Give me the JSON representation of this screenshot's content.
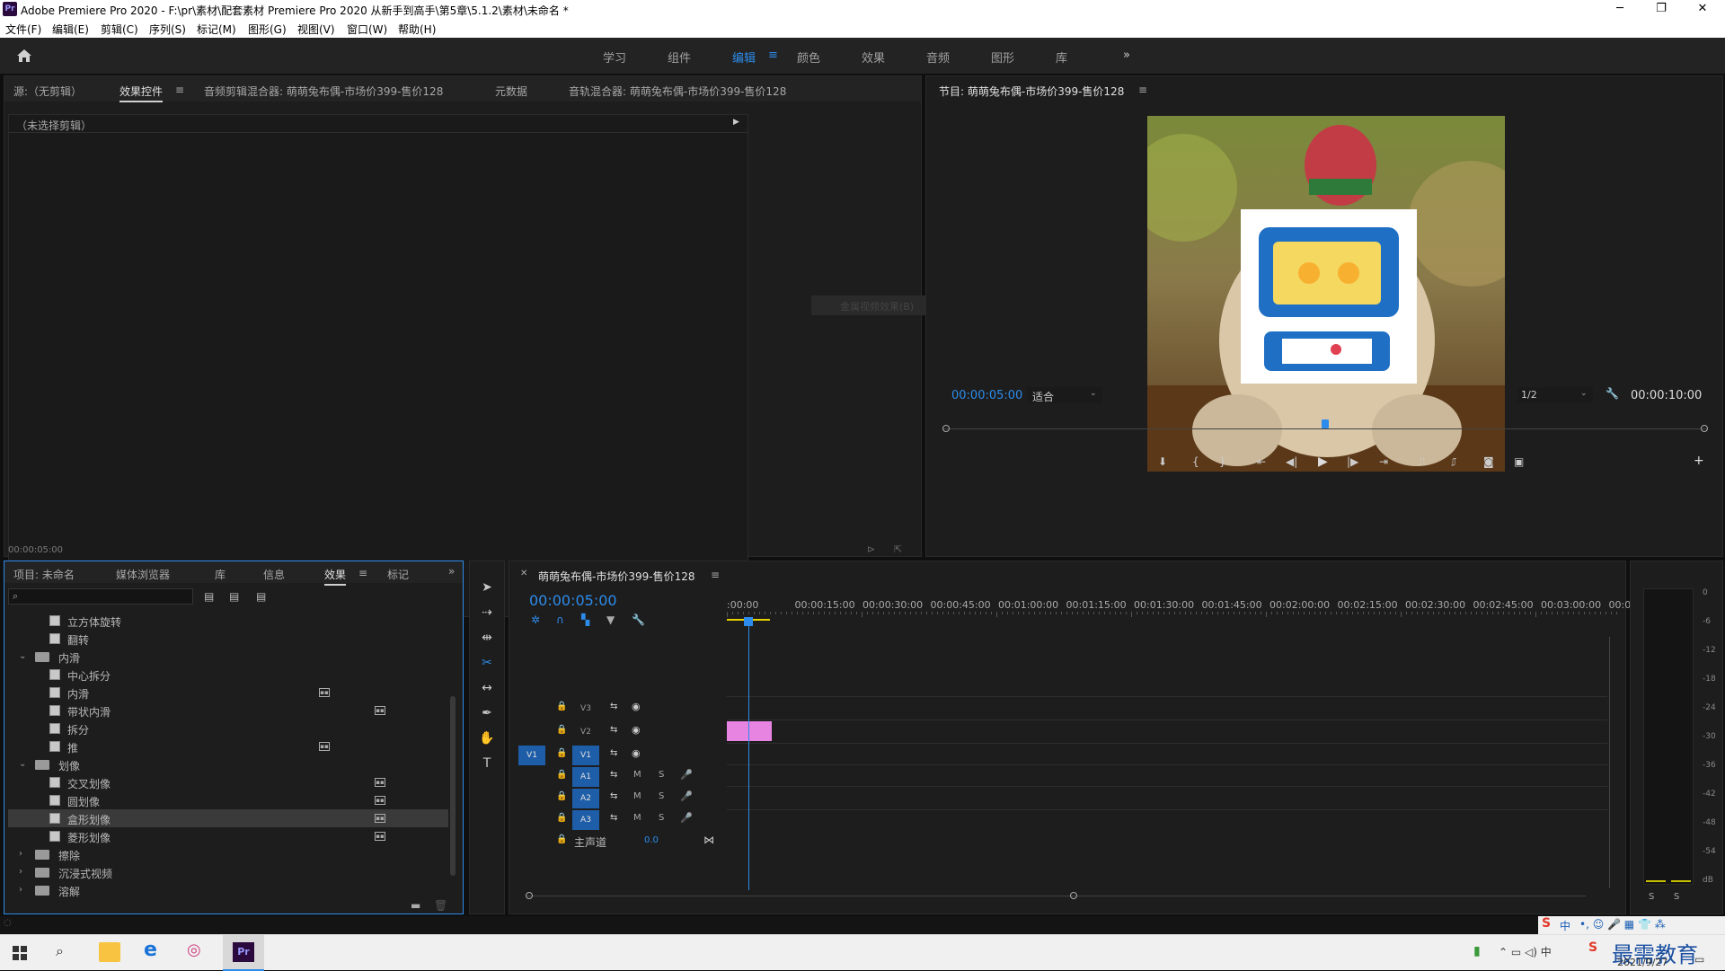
{
  "window": {
    "title": "Adobe Premiere Pro 2020 - F:\\pr\\素材\\配套素材 Premiere Pro 2020 从新手到高手\\第5章\\5.1.2\\素材\\未命名 *",
    "app_icon": "Pr"
  },
  "window_controls": {
    "minimize": "─",
    "restore": "❐",
    "close": "✕"
  },
  "menu": [
    "文件(F)",
    "编辑(E)",
    "剪辑(C)",
    "序列(S)",
    "标记(M)",
    "图形(G)",
    "视图(V)",
    "窗口(W)",
    "帮助(H)"
  ],
  "workspaces": {
    "items": [
      "学习",
      "组件",
      "编辑",
      "颜色",
      "效果",
      "音频",
      "图形",
      "库"
    ],
    "active": "编辑",
    "more": "»"
  },
  "source_panel": {
    "tabs": [
      "源:（无剪辑）",
      "效果控件",
      "音频剪辑混合器: 萌萌兔布偶-市场价399-售价128",
      "元数据",
      "音轨混合器: 萌萌兔布偶-市场价399-售价128"
    ],
    "active_tab": "效果控件",
    "no_clip": "（未选择剪辑）",
    "timecode": "00:00:05:00",
    "ghost_text": "金属视频效果(B)"
  },
  "program_monitor": {
    "title": "节目: 萌萌兔布偶-市场价399-售价128",
    "timecode": "00:00:05:00",
    "fit": "适合",
    "resolution": "1/2",
    "duration": "00:00:10:00",
    "playhead_fraction": 0.5
  },
  "project_panel": {
    "tabs": [
      "项目: 未命名",
      "媒体浏览器",
      "库",
      "信息",
      "效果",
      "标记"
    ],
    "active_tab": "效果",
    "more": "»",
    "search_placeholder": "",
    "items": [
      {
        "type": "effect",
        "label": "立方体旋转",
        "depth": 2
      },
      {
        "type": "effect",
        "label": "翻转",
        "depth": 2
      },
      {
        "type": "folder",
        "label": "内滑",
        "open": true
      },
      {
        "type": "effect",
        "label": "中心拆分",
        "depth": 2
      },
      {
        "type": "effect",
        "label": "内滑",
        "depth": 2,
        "badge": "mid"
      },
      {
        "type": "effect",
        "label": "带状内滑",
        "depth": 2,
        "badge": "right"
      },
      {
        "type": "effect",
        "label": "拆分",
        "depth": 2
      },
      {
        "type": "effect",
        "label": "推",
        "depth": 2,
        "badge": "mid"
      },
      {
        "type": "folder",
        "label": "划像",
        "open": true
      },
      {
        "type": "effect",
        "label": "交叉划像",
        "depth": 2,
        "badge": "right"
      },
      {
        "type": "effect",
        "label": "圆划像",
        "depth": 2,
        "badge": "right"
      },
      {
        "type": "effect",
        "label": "盒形划像",
        "depth": 2,
        "badge": "right",
        "selected": true
      },
      {
        "type": "effect",
        "label": "菱形划像",
        "depth": 2,
        "badge": "right"
      },
      {
        "type": "folder",
        "label": "擦除",
        "open": false
      },
      {
        "type": "folder",
        "label": "沉浸式视频",
        "open": false
      },
      {
        "type": "folder",
        "label": "溶解",
        "open": false
      }
    ]
  },
  "timeline": {
    "title": "萌萌兔布偶-市场价399-售价128",
    "timecode": "00:00:05:00",
    "ruler": [
      ":00:00",
      "00:00:15:00",
      "00:00:30:00",
      "00:00:45:00",
      "00:01:00:00",
      "00:01:15:00",
      "00:01:30:00",
      "00:01:45:00",
      "00:02:00:00",
      "00:02:15:00",
      "00:02:30:00",
      "00:02:45:00",
      "00:03:00:00",
      "00:03:"
    ],
    "video_tracks": [
      "V3",
      "V2",
      "V1"
    ],
    "audio_tracks": [
      "A1",
      "A2",
      "A3"
    ],
    "source_patch": "V1",
    "master_label": "主声道",
    "master_value": "0.0",
    "mute": "M",
    "solo": "S"
  },
  "audio_meter": {
    "scale": [
      "0",
      "-6",
      "-12",
      "-18",
      "-24",
      "-30",
      "-36",
      "-42",
      "-48",
      "-54",
      "dB"
    ],
    "solo": [
      "S",
      "S"
    ]
  },
  "taskbar": {
    "time": "2021/9/27",
    "ime": "中",
    "watermark": "最需教育"
  },
  "colors": {
    "accent": "#2d8ceb",
    "clip": "#e783e0",
    "panel": "#1d1d1d"
  }
}
